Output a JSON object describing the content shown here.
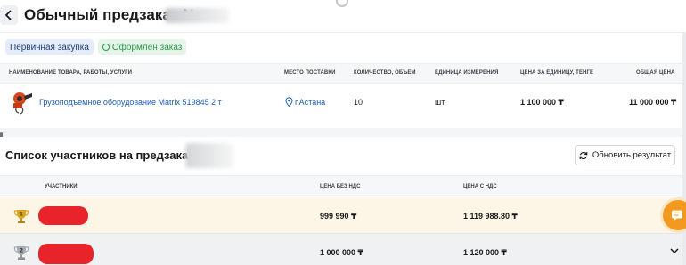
{
  "header": {
    "title": "Обычный предзаказ №"
  },
  "order": {
    "badges": {
      "primary": "Первичная закупка",
      "status": "Оформлен заказ"
    },
    "columns": {
      "name": "Наименование товара, работы, услуги",
      "place": "Место поставки",
      "quantity": "Количество, объем",
      "unit": "Единица измерения",
      "unit_price": "Цена за единицу, тенге",
      "total": "Общая цена"
    },
    "item": {
      "name": "Грузоподъемное оборудование Matrix 519845 2 т",
      "place": "г.Астана",
      "quantity": "10",
      "unit": "шт",
      "unit_price": "1 100 000 ₸",
      "total": "11 000 000 ₸"
    }
  },
  "participants": {
    "title": "Список участников на предзаказ №",
    "refresh_label": "Обновить результат",
    "columns": {
      "participant": "Участники",
      "price_no_vat": "Цена без НДС",
      "price_vat": "Цена с НДС"
    },
    "rows": [
      {
        "rank": "1",
        "price_no_vat": "999 990 ₸",
        "price_vat": "1 119 988.80 ₸"
      },
      {
        "rank": "2",
        "price_no_vat": "1 000 000 ₸",
        "price_vat": "1 120 000 ₸"
      }
    ]
  },
  "colors": {
    "accent_link": "#1b5fb4",
    "status_green": "#2c9a4b",
    "winner_row": "#fdf6e6",
    "redaction": "#e8242a",
    "fab": "#f39a1e"
  },
  "icons": {
    "back": "chevron-left-icon",
    "location": "map-pin-icon",
    "refresh": "refresh-icon",
    "rank1": "gold-trophy-icon",
    "rank2": "silver-trophy-icon",
    "chat": "chat-icon",
    "expand": "chevron-down-icon"
  }
}
